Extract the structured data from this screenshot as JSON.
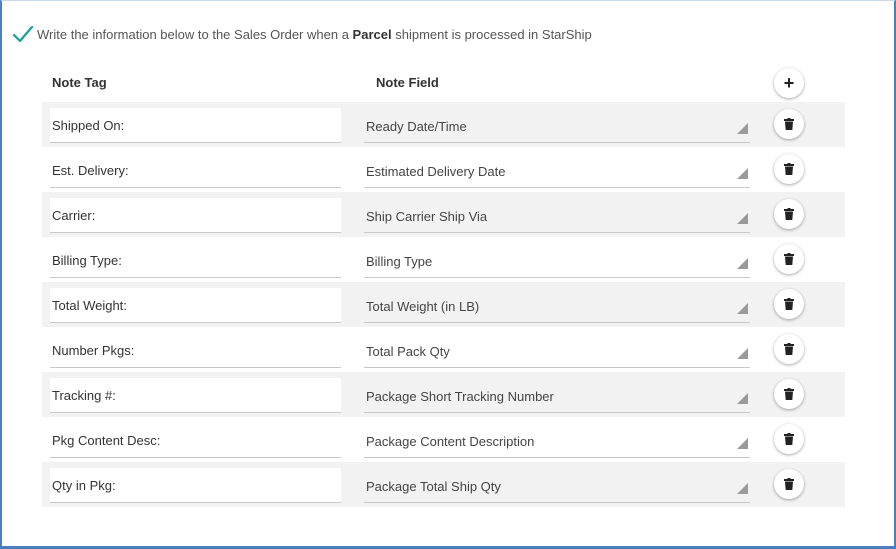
{
  "header": {
    "prefix": "Write the information below to the Sales Order when a",
    "emphasis": "Parcel",
    "suffix": "shipment is processed in StarShip",
    "icon": "checkmark-icon",
    "accent_color": "#1a9e9a"
  },
  "columns": {
    "tag": "Note Tag",
    "field": "Note Field"
  },
  "add_button": {
    "label": "+"
  },
  "rows": [
    {
      "tag": "Shipped On:",
      "field": "Ready Date/Time"
    },
    {
      "tag": "Est. Delivery:",
      "field": "Estimated Delivery Date"
    },
    {
      "tag": "Carrier:",
      "field": "Ship Carrier Ship Via"
    },
    {
      "tag": "Billing Type:",
      "field": "Billing Type"
    },
    {
      "tag": "Total Weight:",
      "field": "Total Weight (in LB)"
    },
    {
      "tag": "Number Pkgs:",
      "field": "Total Pack Qty"
    },
    {
      "tag": "Tracking #:",
      "field": "Package Short Tracking Number"
    },
    {
      "tag": "Pkg Content Desc:",
      "field": "Package Content Description"
    },
    {
      "tag": "Qty in Pkg:",
      "field": "Package Total Ship Qty"
    }
  ]
}
